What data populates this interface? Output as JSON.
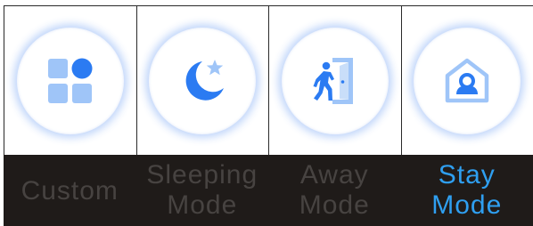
{
  "modes": [
    {
      "key": "custom",
      "icon": "grid-shapes-icon",
      "label_line1": "Custom",
      "label_line2": "",
      "selected": false
    },
    {
      "key": "sleeping",
      "icon": "moon-star-icon",
      "label_line1": "Sleeping",
      "label_line2": "Mode",
      "selected": false
    },
    {
      "key": "away",
      "icon": "person-leaving-door-icon",
      "label_line1": "Away",
      "label_line2": "Mode",
      "selected": false
    },
    {
      "key": "stay",
      "icon": "person-in-house-icon",
      "label_line1": "Stay",
      "label_line2": "Mode",
      "selected": true
    }
  ],
  "colors": {
    "icon_blue": "#2b7bf2",
    "icon_light_blue": "#9fc5f8",
    "label_inactive": "#474341",
    "label_active": "#2f9ff0",
    "label_bar_background": "#1f1b19"
  }
}
